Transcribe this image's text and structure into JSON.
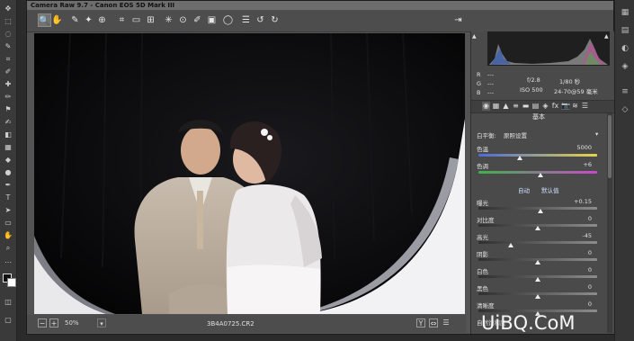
{
  "window": {
    "title": "Camera Raw 9.7 -  Canon EOS 5D Mark III"
  },
  "toolbar": {
    "tools": [
      {
        "name": "zoom-tool",
        "glyph": "🔍"
      },
      {
        "name": "hand-tool",
        "glyph": "✋"
      },
      {
        "name": "white-balance-tool",
        "glyph": "✎"
      },
      {
        "name": "color-sampler-tool",
        "glyph": "✦"
      },
      {
        "name": "targeted-adjustment-tool",
        "glyph": "⊕"
      },
      {
        "name": "crop-tool",
        "glyph": "⌗"
      },
      {
        "name": "straighten-tool",
        "glyph": "▭"
      },
      {
        "name": "transform-tool",
        "glyph": "⊞"
      },
      {
        "name": "spot-removal-tool",
        "glyph": "✳"
      },
      {
        "name": "red-eye-tool",
        "glyph": "⊙"
      },
      {
        "name": "adjustment-brush-tool",
        "glyph": "✐"
      },
      {
        "name": "graduated-filter-tool",
        "glyph": "▣"
      },
      {
        "name": "radial-filter-tool",
        "glyph": "◯"
      },
      {
        "name": "preferences-button",
        "glyph": "☰"
      },
      {
        "name": "rotate-left-button",
        "glyph": "↺"
      },
      {
        "name": "rotate-right-button",
        "glyph": "↻"
      }
    ],
    "export_glyph": "⇥"
  },
  "status": {
    "minus": "−",
    "plus": "+",
    "zoom": "50%",
    "zoom_dd": "▾",
    "filename": "3B4A0725.CR2",
    "view_y": "Y",
    "view_compare": "⇔",
    "view_settings": "☰"
  },
  "info": {
    "r_label": "R",
    "r_val": "---",
    "g_label": "G",
    "g_val": "---",
    "b_label": "B",
    "b_val": "---",
    "aperture": "f/2.8",
    "shutter": "1/80 秒",
    "iso": "ISO 500",
    "lens": "24-70@59 毫米"
  },
  "tabs": [
    "◉",
    "▦",
    "▲",
    "≡",
    "▬",
    "▤",
    "◈",
    "fx",
    "📷",
    "≋",
    "☰"
  ],
  "panel": {
    "section_title": "基本",
    "wb_label": "白平衡:",
    "wb_value": "原照设置",
    "wb_dd": "▾",
    "temp_label": "色温",
    "temp_value": "5000",
    "tint_label": "色调",
    "tint_value": "+6",
    "auto_label": "自动",
    "default_label": "默认值",
    "adjust": [
      {
        "label": "曝光",
        "value": "+0.15",
        "pos": 0.52
      },
      {
        "label": "对比度",
        "value": "0",
        "pos": 0.5
      },
      {
        "label": "高光",
        "value": "-45",
        "pos": 0.27
      },
      {
        "label": "阴影",
        "value": "0",
        "pos": 0.5
      },
      {
        "label": "白色",
        "value": "0",
        "pos": 0.5
      },
      {
        "label": "黑色",
        "value": "0",
        "pos": 0.5
      },
      {
        "label": "清晰度",
        "value": "0",
        "pos": 0.5
      },
      {
        "label": "自然饱和度",
        "value": ""
      }
    ],
    "temp_pos": 0.35,
    "tint_pos": 0.52
  },
  "watermark": "UiBQ.CoM",
  "colors": {
    "accent": "#efefef",
    "panel_bg": "#4a4a4a",
    "preview_bg": "#0b0b0d"
  }
}
